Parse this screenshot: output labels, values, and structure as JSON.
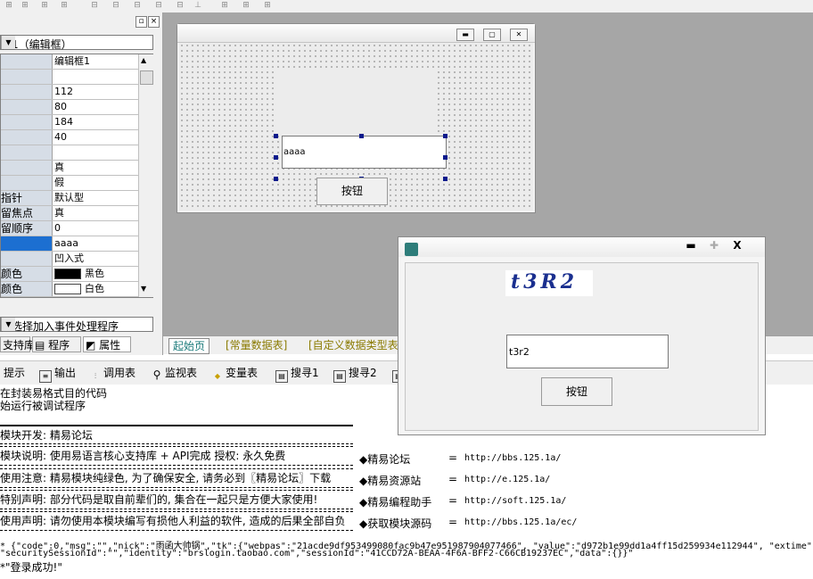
{
  "property_panel": {
    "object_selector": "框1（编辑框）",
    "rows": [
      {
        "key": "",
        "value": "编辑框1"
      },
      {
        "key": "",
        "value": ""
      },
      {
        "key": "",
        "value": "112"
      },
      {
        "key": "",
        "value": "80"
      },
      {
        "key": "",
        "value": "184"
      },
      {
        "key": "",
        "value": "40"
      },
      {
        "key": "",
        "value": ""
      },
      {
        "key": "",
        "value": "真"
      },
      {
        "key": "",
        "value": "假"
      },
      {
        "key": "指针",
        "value": "默认型"
      },
      {
        "key": "留焦点",
        "value": "真"
      },
      {
        "key": "留顺序",
        "value": "0"
      },
      {
        "key": "",
        "value": "aaaa"
      },
      {
        "key": "",
        "value": "凹入式"
      },
      {
        "key": "颜色",
        "value": "黑色",
        "swatch": "#000000"
      },
      {
        "key": "颜色",
        "value": "白色",
        "swatch": "#ffffff"
      }
    ],
    "event_selector": "处选择加入事件处理程序",
    "bottom_tabs": [
      "支持库",
      "程序",
      "属性"
    ]
  },
  "form_designer": {
    "edit_text": "aaaa",
    "button_label": "按钮"
  },
  "source_tabs": [
    "起始页",
    "[常量数据表]",
    "[自定义数据类型表"
  ],
  "output_toolbar": [
    "提示",
    "输出",
    "调用表",
    "监视表",
    "变量表",
    "搜寻1",
    "搜寻2"
  ],
  "output": {
    "lines": [
      "在封装易格式目的代码",
      "始运行被调试程序"
    ],
    "boxes": [
      "模块开发: 精易论坛",
      "模块说明: 使用易语言核心支持库 + API完成        授权: 永久免费",
      "使用注意: 精易模块纯绿色, 为了确保安全, 请务必到〖精易论坛〗下载",
      "特别声明: 部分代码是取自前辈们的, 集合在一起只是方便大家使用!",
      "使用声明: 请勿使用本模块编写有损他人利益的软件, 造成的后果全部自负"
    ],
    "links": [
      {
        "name": "◆精易论坛",
        "url": "http://bbs.125.1a/"
      },
      {
        "name": "◆精易资源站",
        "url": "http://e.125.1a/"
      },
      {
        "name": "◆精易编程助手",
        "url": "http://soft.125.1a/"
      },
      {
        "name": "◆获取模块源码",
        "url": "http://bbs.125.1a/ec/"
      }
    ],
    "json_line1": "* {\"code\":0,\"msg\":\"\",\"nick\":\"雨函大帅锅\",\"tk\":{\"webpas\":\"21acde9df953499080fac9b47e951987904077466\", \"value\":\"d972b1e99dd1a4ff15d259934e112944\", \"extime\"",
    "json_line2": " \"securitySessionId\":\"\",\"identity\":\"brslogin.taobao.com\",\"sessionId\":\"41CCD72A-BEAA-4F6A-BFF2-C66CB19237EC\",\"data\":{}}\"",
    "json_line3": "*\"登录成功!\""
  },
  "runtime_window": {
    "captcha_text": "t3R2",
    "input_value": "t3r2",
    "button_label": "按钮",
    "title_buttons": [
      "▬",
      "✚",
      "X"
    ]
  }
}
